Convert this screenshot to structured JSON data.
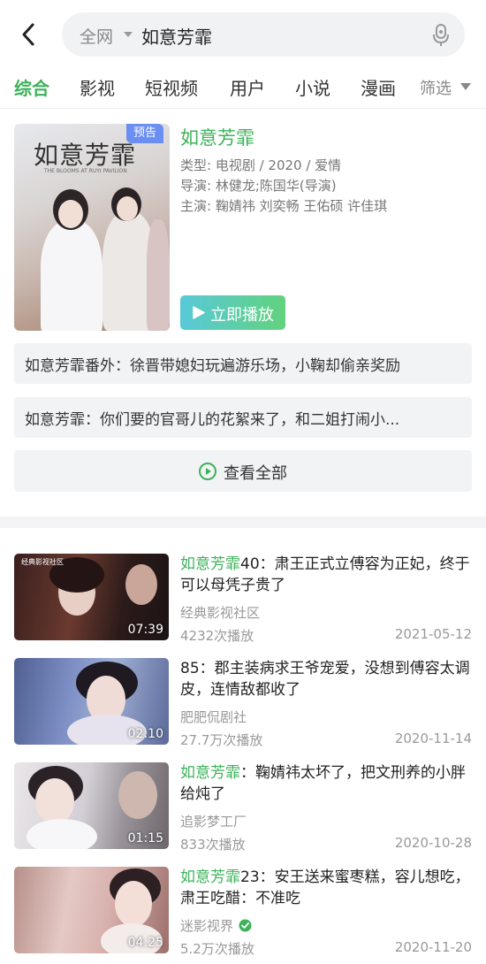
{
  "header": {
    "search_scope": "全网",
    "search_query": "如意芳霏"
  },
  "tabs": [
    "综合",
    "影视",
    "短视频",
    "用户",
    "小说",
    "漫画"
  ],
  "filter_label": "筛选",
  "movie": {
    "poster_title": "如意芳霏",
    "poster_subtitle": "THE BLOOMS AT RUYI PAVILION",
    "badge": "预告",
    "title": "如意芳霏",
    "type_line": "类型: 电视剧 / 2020 / 爱情",
    "director_line": "导演: 林健龙;陈国华(导演)",
    "cast_line": "主演: 鞠婧祎  刘奕畅  王佑硕  许佳琪",
    "play_button": "立即播放"
  },
  "related": [
    "如意芳霏番外：徐晋带媳妇玩遍游乐场，小鞠却偷亲奖励",
    "如意芳霏：你们要的官哥儿的花絮来了，和二姐打闹小..."
  ],
  "view_all": "查看全部",
  "videos": [
    {
      "title_highlight": "如意芳霏",
      "title_rest": "40：肃王正式立傅容为正妃，终于可以母凭子贵了",
      "watermark": "经典影视社区",
      "duration": "07:39",
      "source": "经典影视社区",
      "plays": "4232次播放",
      "date": "2021-05-12",
      "verified": false
    },
    {
      "title_highlight": "",
      "title_rest": "85：郡主装病求王爷宠爱，没想到傅容太调皮，连情敌都收了",
      "watermark": "",
      "duration": "02:10",
      "source": "肥肥侃剧社",
      "plays": "27.7万次播放",
      "date": "2020-11-14",
      "verified": false
    },
    {
      "title_highlight": "如意芳霏",
      "title_rest": "：鞠婧祎太坏了，把文刑养的小胖给炖了",
      "watermark": "",
      "duration": "01:15",
      "source": "追影梦工厂",
      "plays": "833次播放",
      "date": "2020-10-28",
      "verified": false
    },
    {
      "title_highlight": "如意芳霏",
      "title_rest": "23：安王送来蜜枣糕，容儿想吃，肃王吃醋：不准吃",
      "watermark": "",
      "duration": "04:25",
      "source": "迷影视界",
      "plays": "5.2万次播放",
      "date": "2020-11-20",
      "verified": true
    }
  ],
  "colors": {
    "accent_green": "#3db25a",
    "badge_blue": "#6b8ef2",
    "gray_text": "#999999"
  },
  "icons": [
    "back-arrow-icon",
    "dropdown-caret-icon",
    "microphone-icon",
    "play-triangle-icon",
    "play-circle-icon",
    "verified-check-icon"
  ]
}
